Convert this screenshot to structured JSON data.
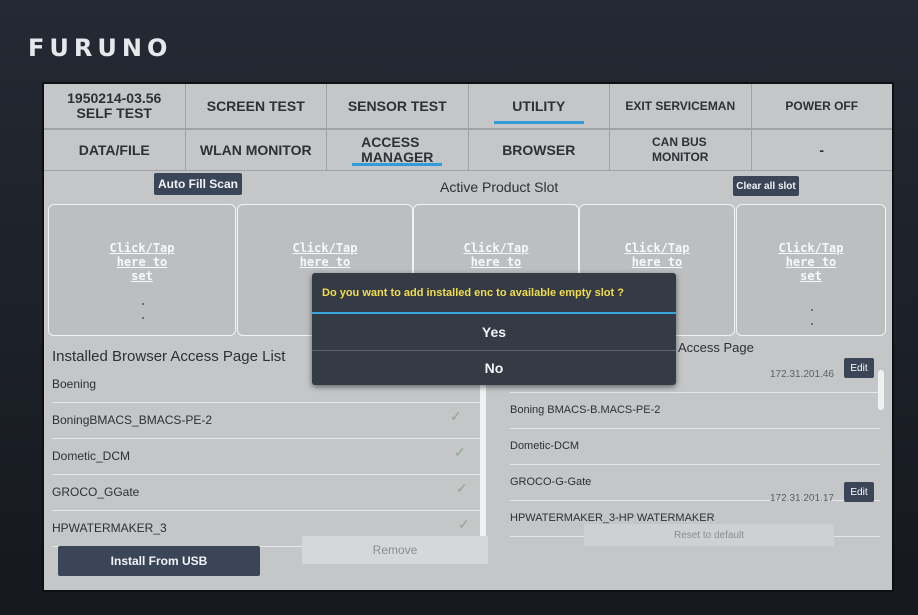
{
  "brand": "FURUNO",
  "menu": {
    "row1": [
      {
        "label": "1950214-03.56\nSELF TEST",
        "active": false
      },
      {
        "label": "SCREEN TEST",
        "active": false
      },
      {
        "label": "SENSOR TEST",
        "active": false
      },
      {
        "label": "UTILITY",
        "active": true
      },
      {
        "label": "EXIT SERVICEMAN",
        "active": false
      },
      {
        "label": "POWER OFF",
        "active": false
      }
    ],
    "row2": [
      {
        "label": "DATA/FILE",
        "active": false
      },
      {
        "label": "WLAN MONITOR",
        "active": false
      },
      {
        "label": "ACCESS\nMANAGER",
        "active": true
      },
      {
        "label": "BROWSER",
        "active": false
      },
      {
        "label": "CAN BUS\nMONITOR",
        "active": false
      },
      {
        "label": "-",
        "active": false
      }
    ]
  },
  "slots": {
    "auto_fill_label": "Auto Fill Scan",
    "title": "Active Product Slot",
    "clear_label": "Clear all slot",
    "items": [
      {
        "text": "Click/Tap\nhere to\nset"
      },
      {
        "text": "Click/Tap\nhere to"
      },
      {
        "text": "Click/Tap\nhere to"
      },
      {
        "text": "Click/Tap\nhere to"
      },
      {
        "text": "Click/Tap\nhere to\nset"
      }
    ]
  },
  "installed": {
    "title": "Installed Browser Access Page List",
    "items": [
      "Boening",
      "BoningBMACS_BMACS-PE-2",
      "Dometic_DCM",
      "GROCO_GGate",
      "HPWATERMAKER_3"
    ],
    "install_label": "Install From USB",
    "remove_label": "Remove"
  },
  "access": {
    "title": "Access Page",
    "items": [
      {
        "name": "",
        "ip": "172.31.201.46",
        "edit": "Edit"
      },
      {
        "name": "Boning BMACS-B.MACS-PE-2",
        "ip": "",
        "edit": ""
      },
      {
        "name": "Dometic-DCM",
        "ip": "",
        "edit": ""
      },
      {
        "name": "GROCO-G-Gate",
        "ip": "",
        "edit": ""
      },
      {
        "name": "HPWATERMAKER_3-HP WATERMAKER",
        "ip": "172.31.201.17",
        "edit": "Edit"
      }
    ],
    "reset_label": "Reset to default"
  },
  "dialog": {
    "message": "Do you want to add installed enc to available empty slot ?",
    "yes": "Yes",
    "no": "No"
  },
  "colors": {
    "accent": "#2f9bd8",
    "dialog_bg": "#353b44",
    "dialog_text": "#f1dd4f"
  }
}
